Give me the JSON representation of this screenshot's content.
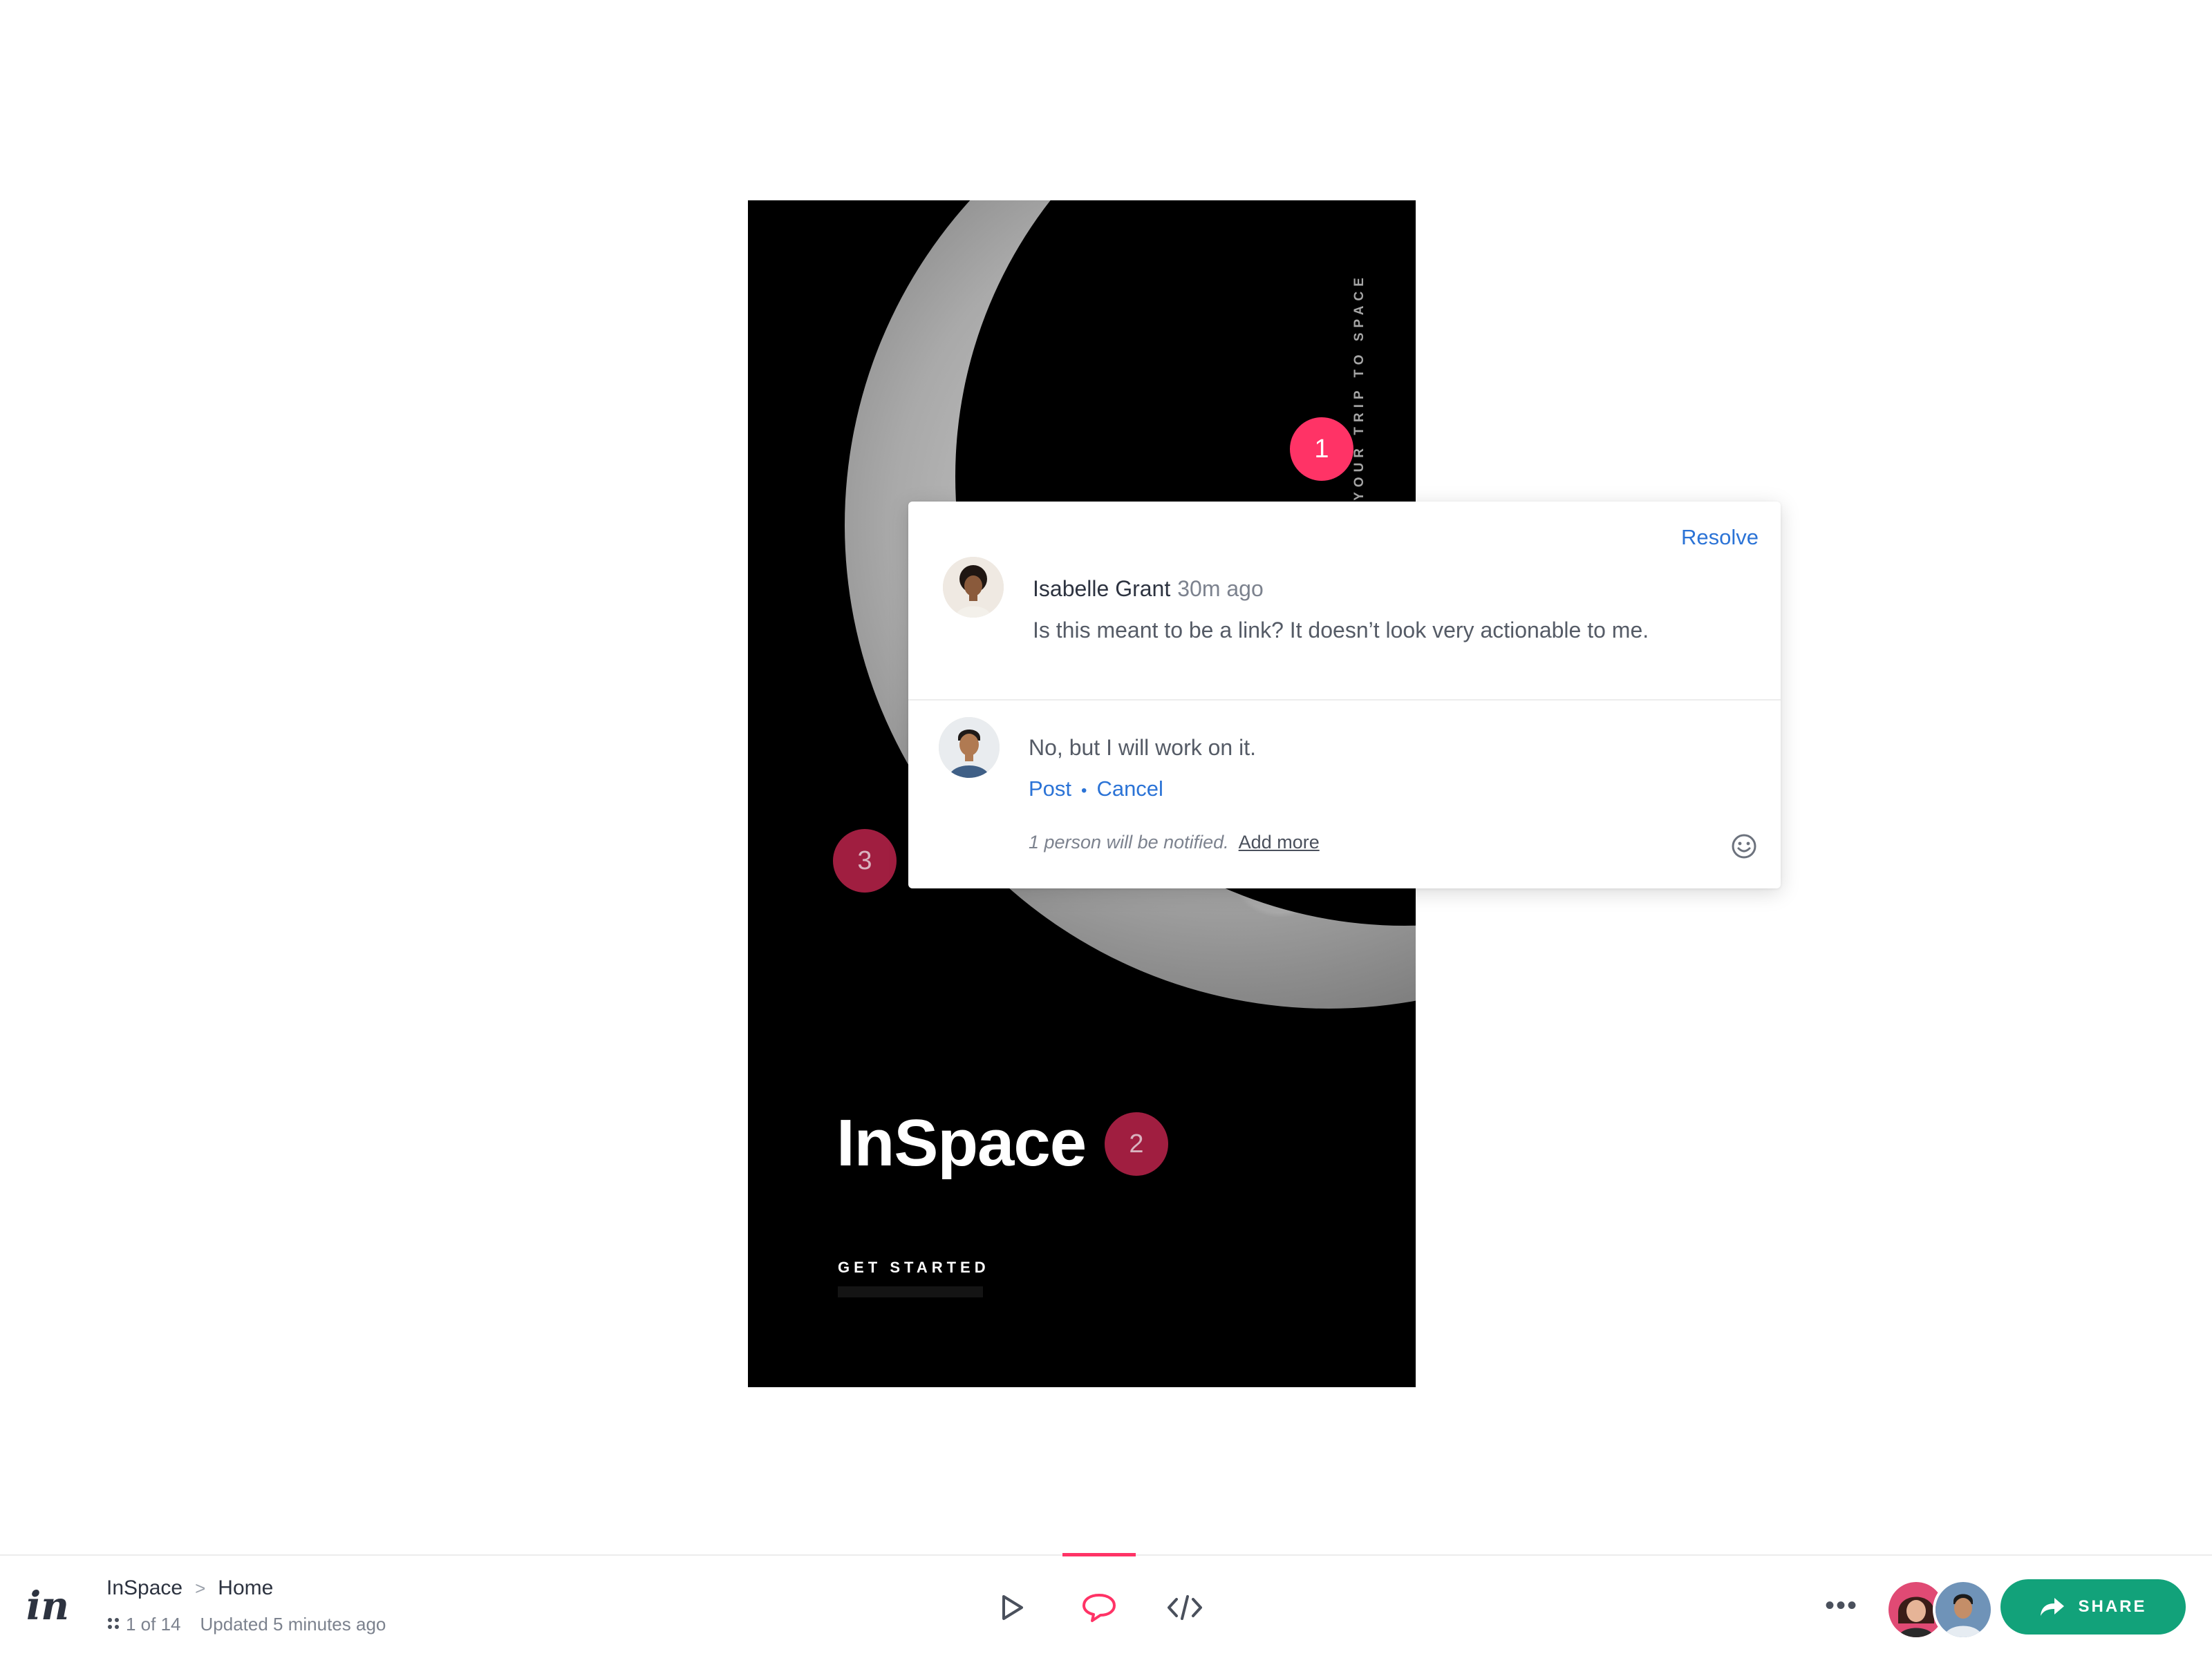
{
  "screen": {
    "vertical_tagline": "YOUR TRIP TO SPACE",
    "app_title": "InSpace",
    "cta_label": "GET STARTED"
  },
  "pins": [
    {
      "number": "1",
      "state": "active"
    },
    {
      "number": "2",
      "state": "inactive"
    },
    {
      "number": "3",
      "state": "inactive"
    }
  ],
  "comment_thread": {
    "resolve_label": "Resolve",
    "comment": {
      "author": "Isabelle Grant",
      "time": "30m ago",
      "text": "Is this meant to be a link? It doesn’t look very actionable to me."
    },
    "reply": {
      "text": "No, but I will work on it.",
      "post_label": "Post",
      "separator": "•",
      "cancel_label": "Cancel",
      "notify_text": "1 person will be notified.",
      "add_more_label": "Add more"
    }
  },
  "bottom_bar": {
    "logo": "in",
    "breadcrumb": {
      "project": "InSpace",
      "separator": ">",
      "screen": "Home"
    },
    "screen_position": "1 of 14",
    "updated": "Updated 5 minutes ago",
    "modes": [
      "play-icon",
      "comment-icon",
      "code-icon"
    ],
    "active_mode": "comment",
    "more_label": "•••",
    "share_label": "SHARE"
  },
  "colors": {
    "accent": "#ff3366",
    "link": "#2b73d6",
    "share": "#12a27a",
    "pin_inactive": "#a01e40"
  }
}
